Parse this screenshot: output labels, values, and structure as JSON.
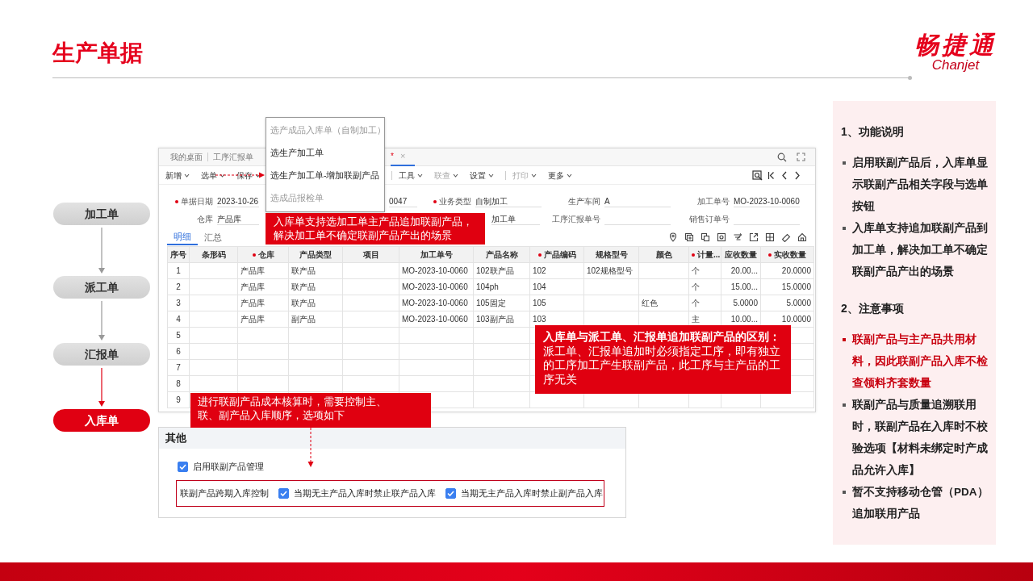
{
  "header": {
    "title": "生产单据",
    "logo": {
      "name": "畅捷通",
      "latin": "Chanjet"
    }
  },
  "flow": [
    {
      "label": "加工单",
      "selected": false
    },
    {
      "label": "派工单",
      "selected": false
    },
    {
      "label": "汇报单",
      "selected": false
    },
    {
      "label": "入库单",
      "selected": true
    }
  ],
  "app": {
    "tabs": [
      {
        "label": "我的桌面",
        "selected": false
      },
      {
        "label": "工序汇报单",
        "selected": false
      },
      {
        "label": "*",
        "close": "×",
        "selected": true
      }
    ],
    "toolbar": [
      [
        {
          "label": "新增",
          "disabled": false
        },
        {
          "label": "选单",
          "disabled": false
        },
        {
          "label": "保存",
          "disabled": false
        }
      ],
      [
        {
          "label": "工具",
          "disabled": false
        },
        {
          "label": "联查",
          "disabled": true
        },
        {
          "label": "设置",
          "disabled": false
        }
      ],
      [
        {
          "label": "打印",
          "disabled": true
        },
        {
          "label": "更多",
          "disabled": false
        }
      ]
    ],
    "form": [
      [
        {
          "label": "单据日期",
          "required": true,
          "value": "2023-10-26"
        },
        {
          "value": "0047"
        },
        {
          "label": "业务类型",
          "required": true,
          "value": "自制加工"
        },
        {
          "label": "生产车间",
          "value": "A"
        },
        {
          "label": "加工单号",
          "value": "MO-2023-10-0060"
        }
      ],
      [
        {
          "label": "仓库",
          "value": "产品库"
        },
        {
          "value": "加工单"
        },
        {
          "label": "工序汇报单号"
        },
        {
          "label": "销售订单号"
        }
      ]
    ],
    "detail_tabs": [
      {
        "label": "明细",
        "selected": true
      },
      {
        "label": "汇总",
        "selected": false
      }
    ],
    "table": {
      "columns": [
        {
          "label": "序号"
        },
        {
          "label": "条形码"
        },
        {
          "label": "仓库",
          "required": true
        },
        {
          "label": "产品类型"
        },
        {
          "label": "项目"
        },
        {
          "label": "加工单号"
        },
        {
          "label": "产品名称"
        },
        {
          "label": "产品编码",
          "required": true
        },
        {
          "label": "规格型号"
        },
        {
          "label": "颜色"
        },
        {
          "label": "计量...",
          "required": true
        },
        {
          "label": "应收数量",
          "kind": "number"
        },
        {
          "label": "实收数量",
          "required": true,
          "kind": "number"
        }
      ],
      "rows": [
        [
          "1",
          null,
          "产品库",
          "联产品",
          null,
          "MO-2023-10-0060",
          "102联产品",
          "102",
          "102规格型号",
          null,
          "个",
          "20.00...",
          "20.0000"
        ],
        [
          "2",
          null,
          "产品库",
          "联产品",
          null,
          "MO-2023-10-0060",
          "104ph",
          "104",
          null,
          null,
          "个",
          "15.00...",
          "15.0000"
        ],
        [
          "3",
          null,
          "产品库",
          "联产品",
          null,
          "MO-2023-10-0060",
          "105固定",
          "105",
          null,
          "红色",
          "个",
          "5.0000",
          "5.0000"
        ],
        [
          "4",
          null,
          "产品库",
          "副产品",
          null,
          "MO-2023-10-0060",
          "103副产品",
          "103",
          null,
          null,
          "主",
          "10.00...",
          "10.0000"
        ],
        [
          "5"
        ],
        [
          "6"
        ],
        [
          "7"
        ],
        [
          "8"
        ],
        [
          "9"
        ]
      ]
    }
  },
  "dropdown": [
    {
      "label": "选产成品入库单（自制加工）",
      "disabled": true
    },
    {
      "label": "选生产加工单",
      "disabled": false
    },
    {
      "label": "选生产加工单-增加联副产品",
      "disabled": false
    },
    {
      "label": "选成品报检单",
      "disabled": true
    }
  ],
  "other": {
    "title": "其他",
    "enable": {
      "label": "启用联副产品管理",
      "checked": true
    },
    "control": {
      "label": "联副产品跨期入库控制",
      "options": [
        {
          "label": "当期无主产品入库时禁止联产品入库",
          "checked": true
        },
        {
          "label": "当期无主产品入库时禁止副产品入库",
          "checked": true
        }
      ]
    }
  },
  "callouts": [
    "入库单支持选加工单主产品追加联副产品，解决加工单不确定联副产品产出的场景",
    "**入库单与派工单、汇报单追加联副产品的区别：**派工单、汇报单追加时必须指定工序，即有独立的工序加工产生联副产品，此工序与主产品的工序无关",
    "进行联副产品成本核算时，需要控制主、联、副产品入库顺序，选项如下"
  ],
  "notes": [
    {
      "heading": "1、功能说明",
      "items": [
        {
          "text": "启用联副产品后，入库单显示联副产品相关字段与选单按钮",
          "highlight": false
        },
        {
          "text": "入库单支持追加联副产品到加工单，解决加工单不确定联副产品产出的场景",
          "highlight": false
        }
      ]
    },
    {
      "heading": "2、注意事项",
      "items": [
        {
          "text": "联副产品与主产品共用材料，因此联副产品入库不检查领料齐套数量",
          "highlight": true
        },
        {
          "text": "联副产品与质量追溯联用时，联副产品在入库时不校验选项【材料未绑定时产成品允许入库】",
          "highlight": false
        },
        {
          "text": "暂不支持移动仓管（PDA）追加联用产品",
          "highlight": false
        }
      ]
    }
  ]
}
